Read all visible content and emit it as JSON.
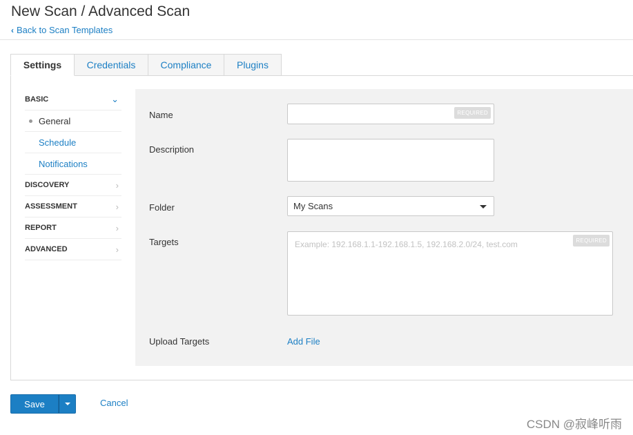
{
  "header": {
    "title": "New Scan / Advanced Scan",
    "back_link": "Back to Scan Templates",
    "back_icon": "‹"
  },
  "tabs": [
    {
      "label": "Settings",
      "active": true
    },
    {
      "label": "Credentials",
      "active": false
    },
    {
      "label": "Compliance",
      "active": false
    },
    {
      "label": "Plugins",
      "active": false
    }
  ],
  "sidebar": {
    "basic": {
      "label": "BASIC",
      "icon": "⌄"
    },
    "basic_items": [
      {
        "label": "General",
        "current": true
      },
      {
        "label": "Schedule",
        "current": false
      },
      {
        "label": "Notifications",
        "current": false
      }
    ],
    "sections": [
      {
        "label": "DISCOVERY",
        "icon": "›"
      },
      {
        "label": "ASSESSMENT",
        "icon": "›"
      },
      {
        "label": "REPORT",
        "icon": "›"
      },
      {
        "label": "ADVANCED",
        "icon": "›"
      }
    ]
  },
  "form": {
    "name_label": "Name",
    "name_value": "",
    "required_badge": "REQUIRED",
    "description_label": "Description",
    "description_value": "",
    "folder_label": "Folder",
    "folder_value": "My Scans",
    "targets_label": "Targets",
    "targets_placeholder": "Example: 192.168.1.1-192.168.1.5, 192.168.2.0/24, test.com",
    "upload_label": "Upload Targets",
    "add_file": "Add File"
  },
  "footer": {
    "save": "Save",
    "cancel": "Cancel"
  },
  "watermark": "CSDN @寂峰听雨",
  "colors": {
    "accent": "#1c7fc4",
    "form_bg": "#f2f2f2",
    "border": "#d8d8d8"
  }
}
